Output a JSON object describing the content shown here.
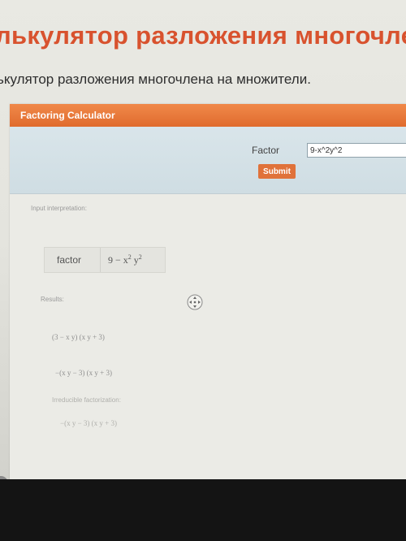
{
  "page": {
    "title": "лькулятор разложения многочле",
    "subtitle": "ькулятор разложения многочлена на множители."
  },
  "widget": {
    "title": "Factoring Calculator",
    "factor_label": "Factor",
    "factor_value": "9-x^2y^2",
    "submit_label": "Submit"
  },
  "interpretation": {
    "label": "Input interpretation:",
    "factor_word": "factor",
    "expr_base": "9 − x",
    "expr_exp1": "2",
    "expr_var": " y",
    "expr_exp2": "2"
  },
  "results": {
    "label": "Results:",
    "items": [
      "(3 − x y) (x y + 3)",
      "−(x y − 3) (x y + 3)"
    ]
  },
  "irreducible": {
    "label": "Irreducible factorization:",
    "value": "−(x y − 3) (x y + 3)"
  },
  "icons": {
    "move": "move-icon",
    "close": "close-icon"
  }
}
